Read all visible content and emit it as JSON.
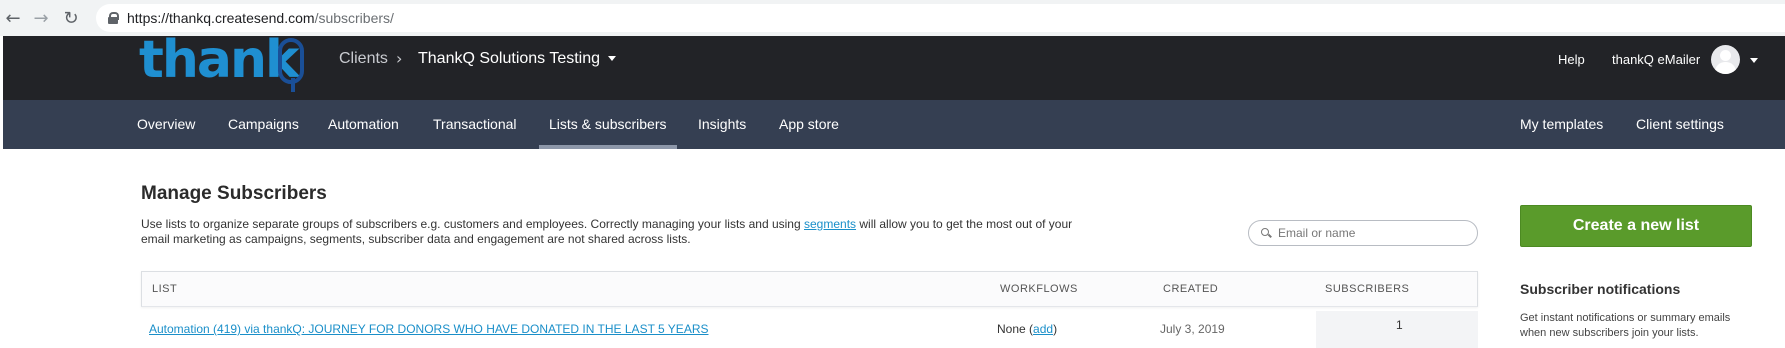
{
  "browser": {
    "url_host": "https://thankq.createsend.com",
    "url_path": "/subscribers/"
  },
  "header": {
    "logo_text": "thank",
    "breadcrumb_clients": "Clients",
    "breadcrumb_separator": "›",
    "client_name": "ThankQ Solutions Testing",
    "help": "Help",
    "user_name": "thankQ eMailer"
  },
  "nav": {
    "items": [
      "Overview",
      "Campaigns",
      "Automation",
      "Transactional",
      "Lists & subscribers",
      "Insights",
      "App store"
    ],
    "active": "Lists & subscribers",
    "right_items": [
      "My templates",
      "Client settings"
    ]
  },
  "main": {
    "title": "Manage Subscribers",
    "intro_before": "Use lists to organize separate groups of subscribers e.g. customers and employees. Correctly managing your lists and using ",
    "intro_link": "segments",
    "intro_after": " will allow you to get the most out of your email marketing as campaigns, segments, subscriber data and engagement are not shared across lists.",
    "search_placeholder": "Email or name"
  },
  "table": {
    "headers": [
      "LIST",
      "WORKFLOWS",
      "CREATED",
      "SUBSCRIBERS"
    ],
    "rows": [
      {
        "list": "Automation (419) via thankQ: JOURNEY FOR DONORS WHO HAVE DONATED IN THE LAST 5 YEARS",
        "workflows_prefix": "None (",
        "workflows_link": "add",
        "workflows_suffix": ")",
        "created": "July 3, 2019",
        "subscribers": "1"
      }
    ]
  },
  "sidebar": {
    "create_button": "Create a new list",
    "notif_title": "Subscriber notifications",
    "notif_text": "Get instant notifications or summary emails when new subscribers join your lists."
  },
  "colors": {
    "header_bg": "#222327",
    "nav_bg": "#353f52",
    "accent_link": "#1a8fc9",
    "create_button": "#5a9b2b",
    "logo_blue": "#1f8fd1"
  }
}
